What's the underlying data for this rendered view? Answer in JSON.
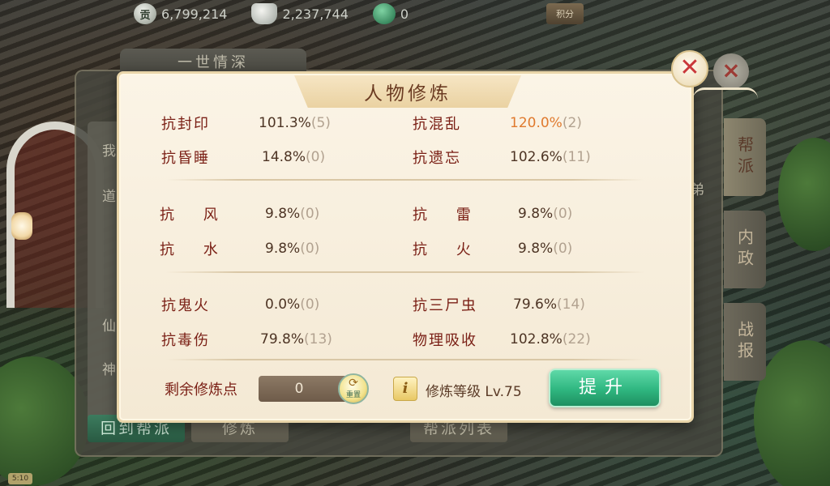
{
  "topbar": {
    "resources": [
      {
        "icon": "silver-coin-icon",
        "glyph": "贡",
        "value": "6,799,214"
      },
      {
        "icon": "silver-ingot-icon",
        "glyph": "",
        "value": "2,237,744"
      },
      {
        "icon": "jade-icon",
        "glyph": "",
        "value": "0"
      }
    ],
    "score_label": "积分"
  },
  "background_panel": {
    "title": "一世情深",
    "left_items": [
      "我",
      "道",
      "仙",
      "神"
    ],
    "right_text": "弟",
    "tabs": [
      "帮派",
      "内政",
      "战报"
    ],
    "bottom_buttons": [
      "回到帮派",
      "修炼",
      "帮派列表"
    ],
    "bottom_tag": "5:10"
  },
  "dialog": {
    "title": "人物修炼",
    "close_glyph": "✕",
    "stats": [
      {
        "label": "抗封印",
        "value": "101.3%",
        "bonus": "(5)",
        "orange": false
      },
      {
        "label": "抗混乱",
        "value": "120.0%",
        "bonus": "(2)",
        "orange": true
      },
      {
        "label": "抗昏睡",
        "value": "14.8%",
        "bonus": "(0)",
        "orange": false
      },
      {
        "label": "抗遗忘",
        "value": "102.6%",
        "bonus": "(11)",
        "orange": false
      },
      {
        "label": "抗 风",
        "value": "9.8%",
        "bonus": "(0)",
        "orange": false
      },
      {
        "label": "抗 雷",
        "value": "9.8%",
        "bonus": "(0)",
        "orange": false
      },
      {
        "label": "抗 水",
        "value": "9.8%",
        "bonus": "(0)",
        "orange": false
      },
      {
        "label": "抗 火",
        "value": "9.8%",
        "bonus": "(0)",
        "orange": false
      },
      {
        "label": "抗鬼火",
        "value": "0.0%",
        "bonus": "(0)",
        "orange": false
      },
      {
        "label": "抗三尸虫",
        "value": "79.6%",
        "bonus": "(14)",
        "orange": false
      },
      {
        "label": "抗毒伤",
        "value": "79.8%",
        "bonus": "(13)",
        "orange": false
      },
      {
        "label": "物理吸收",
        "value": "102.8%",
        "bonus": "(22)",
        "orange": false
      }
    ],
    "remaining_points_label": "剩余修炼点",
    "remaining_points_value": "0",
    "reset_label": "重置",
    "info_glyph": "i",
    "level_label": "修炼等级 Lv.75",
    "upgrade_label": "提升"
  }
}
